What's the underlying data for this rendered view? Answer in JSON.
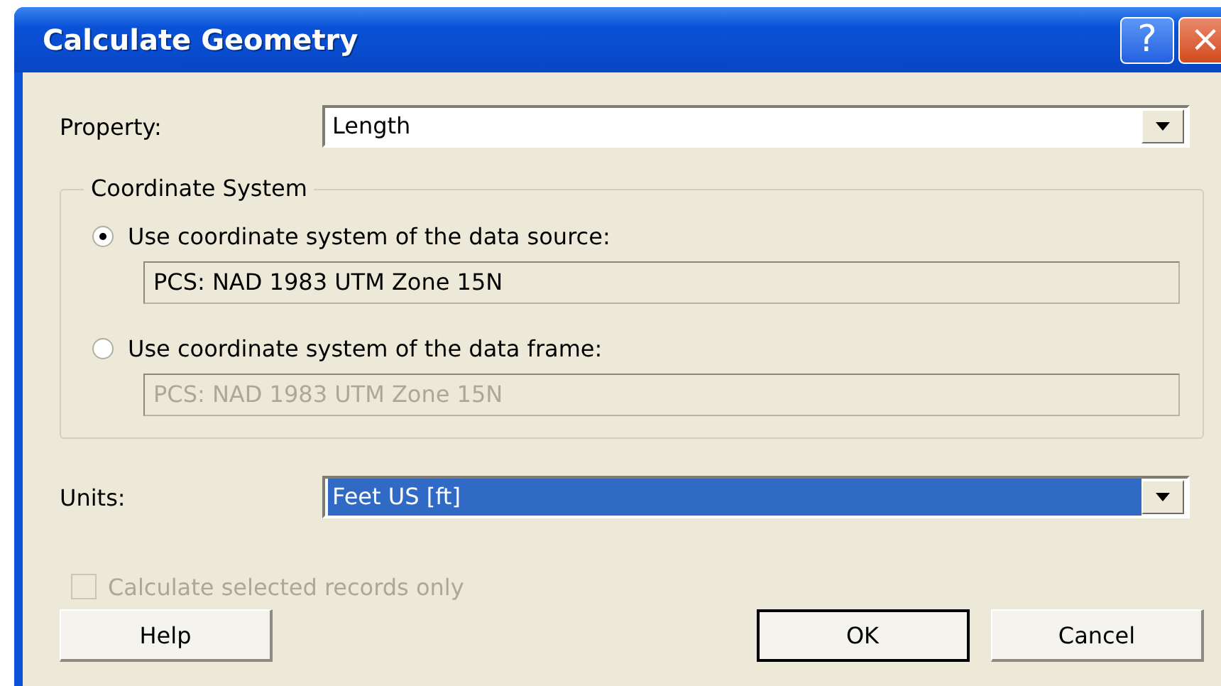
{
  "window": {
    "title": "Calculate Geometry",
    "title_buttons": [
      {
        "kind": "help",
        "label": "?"
      },
      {
        "kind": "close",
        "label": "×"
      }
    ]
  },
  "property": {
    "label": "Property:",
    "value": "Length",
    "selected": false
  },
  "coordinate_system": {
    "title": "Coordinate System",
    "options": [
      {
        "label": "Use coordinate system of the data source:",
        "selected": true,
        "value": "PCS: NAD 1983 UTM Zone 15N"
      },
      {
        "label": "Use coordinate system of the data frame:",
        "selected": false,
        "value": "PCS: NAD 1983 UTM Zone 15N"
      }
    ]
  },
  "units": {
    "label": "Units:",
    "value": "Feet US [ft]",
    "selected": true
  },
  "selected_only": {
    "label": "Calculate selected records only",
    "checked": false,
    "disabled": true
  },
  "buttons": [
    {
      "label": "Help",
      "default": false
    },
    {
      "label": "OK",
      "default": true
    },
    {
      "label": "Cancel",
      "default": false
    }
  ]
}
